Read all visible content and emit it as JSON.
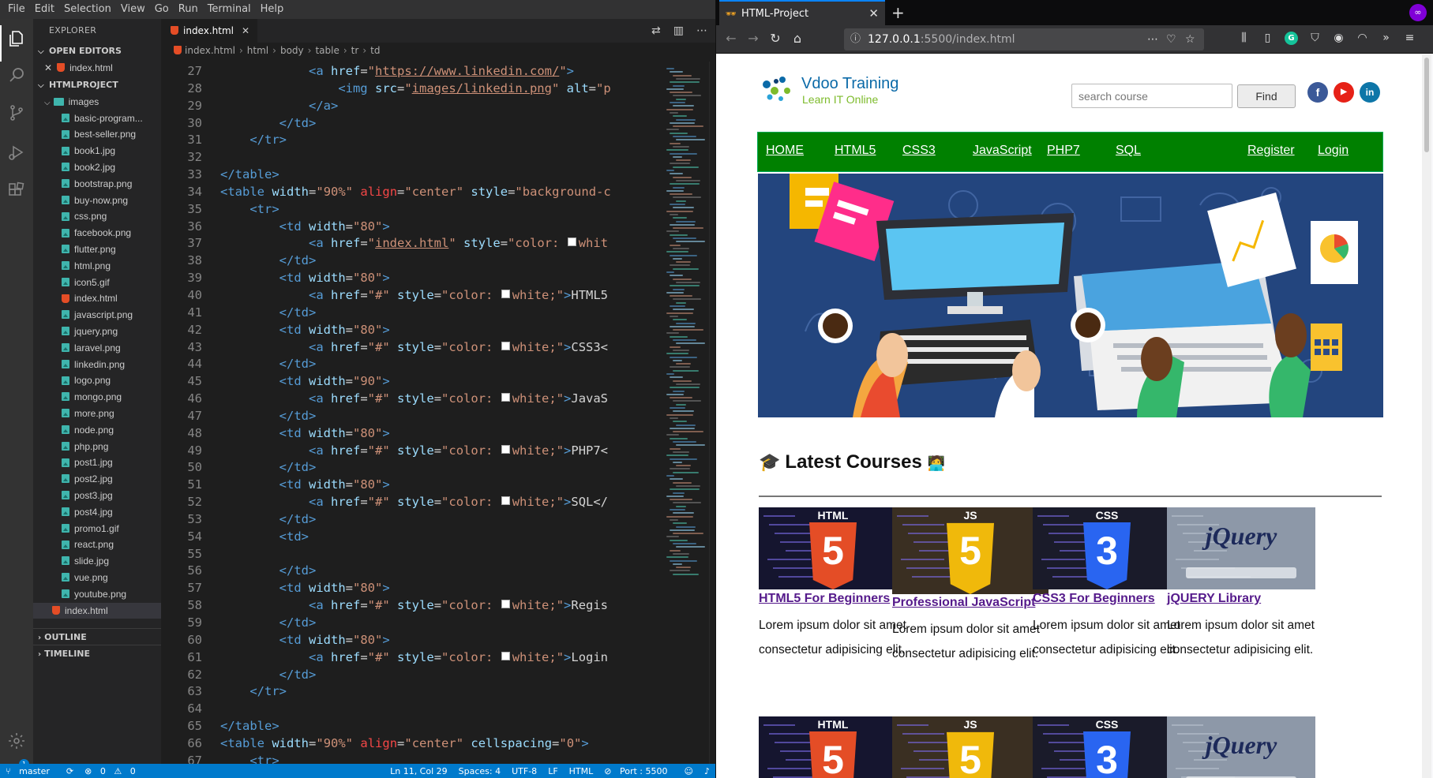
{
  "vscode": {
    "menu": [
      "File",
      "Edit",
      "Selection",
      "View",
      "Go",
      "Run",
      "Terminal",
      "Help"
    ],
    "explorer_title": "EXPLORER",
    "open_editors_label": "OPEN EDITORS",
    "open_editor_file": "index.html",
    "project_label": "HTMLPROJECT",
    "images_folder": "images",
    "files": [
      "basic-program...",
      "best-seller.png",
      "book1.jpg",
      "book2.jpg",
      "bootstrap.png",
      "buy-now.png",
      "css.png",
      "facebook.png",
      "flutter.png",
      "html.png",
      "icon5.gif",
      "index.html",
      "javascript.png",
      "jquery.png",
      "laravel.png",
      "linkedin.png",
      "logo.png",
      "mongo.png",
      "more.png",
      "node.png",
      "php.png",
      "post1.jpg",
      "post2.jpg",
      "post3.jpg",
      "post4.jpg",
      "promo1.gif",
      "react.png",
      "slide.jpg",
      "vue.png",
      "youtube.png"
    ],
    "root_file": "index.html",
    "outline_label": "OUTLINE",
    "timeline_label": "TIMELINE",
    "settings_badge": "1",
    "tab_label": "index.html",
    "breadcrumbs": [
      "index.html",
      "html",
      "body",
      "table",
      "tr",
      "td"
    ],
    "line_numbers": [
      "27",
      "28",
      "29",
      "30",
      "31",
      "32",
      "33",
      "34",
      "35",
      "36",
      "37",
      "38",
      "39",
      "40",
      "41",
      "42",
      "43",
      "44",
      "45",
      "46",
      "47",
      "48",
      "49",
      "50",
      "51",
      "52",
      "53",
      "54",
      "55",
      "56",
      "57",
      "58",
      "59",
      "60",
      "61",
      "62",
      "63",
      "64",
      "65",
      "66",
      "67"
    ],
    "status": {
      "branch": "master",
      "problems": "0",
      "warnings": "0",
      "position": "Ln 11, Col 29",
      "spaces": "Spaces: 4",
      "encoding": "UTF-8",
      "eol": "LF",
      "language": "HTML",
      "port": "Port : 5500"
    }
  },
  "firefox": {
    "tab_title": "HTML-Project",
    "url_host": "127.0.0.1",
    "url_path": ":5500/index.html"
  },
  "site": {
    "brand": "Vdoo Training",
    "tagline": "Learn IT Online",
    "search_placeholder": "search course",
    "find_label": "Find",
    "social": [
      "f",
      "▶",
      "in"
    ],
    "nav": [
      "HOME",
      "HTML5",
      "CSS3",
      "JavaScript",
      "PHP7",
      "SQL",
      "Register",
      "Login"
    ],
    "section_title": "Latest Courses",
    "section_emoji": "🎓",
    "courses": [
      {
        "title": "HTML5 For Beginners",
        "badge": "HTML",
        "glyph": "5",
        "text": "Lorem ipsum dolor sit amet consectetur adipisicing elit."
      },
      {
        "title": "Professional JavaScript",
        "badge": "JS",
        "glyph": "5",
        "text": "Lorem ipsum dolor sit amet consectetur adipisicing elit."
      },
      {
        "title": "CSS3 For Beginners",
        "badge": "CSS",
        "glyph": "3",
        "text": "Lorem ipsum dolor sit amet consectetur adipisicing elit."
      },
      {
        "title": "jQUERY Library",
        "badge": "jQuery",
        "glyph": "",
        "text": "Lorem ipsum dolor sit amet consectetur adipisicing elit."
      }
    ]
  },
  "colors": {
    "nav_green": "#008000",
    "hero_blue": "#23457e",
    "vscode_blue": "#007acc",
    "link_purple": "#551a8b"
  }
}
